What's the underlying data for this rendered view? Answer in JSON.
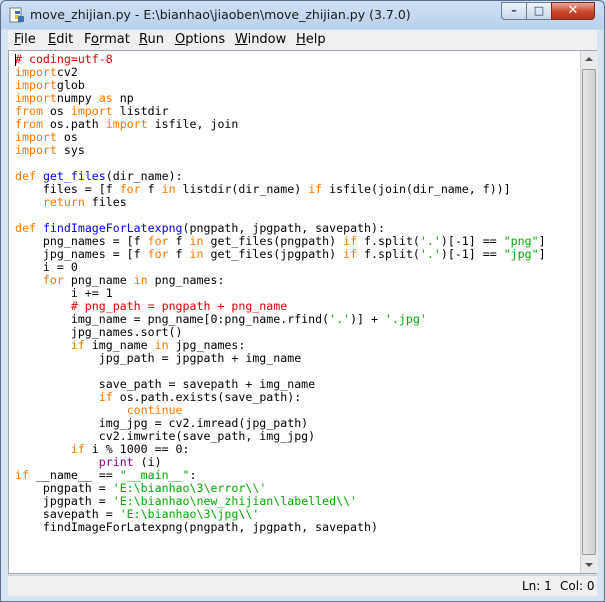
{
  "window": {
    "title": "move_zhijian.py - E:\\bianhao\\jiaoben\\move_zhijian.py (3.7.0)",
    "controls": {
      "minimize": "–",
      "maximize": "□",
      "close": "✕"
    }
  },
  "menu": {
    "items": [
      {
        "access": "F",
        "rest": "ile"
      },
      {
        "access": "E",
        "rest": "dit"
      },
      {
        "access": "",
        "pre": "F",
        "access2": "o",
        "rest": "rmat"
      },
      {
        "access": "R",
        "rest": "un"
      },
      {
        "access": "O",
        "rest": "ptions"
      },
      {
        "access": "W",
        "rest": "indow"
      },
      {
        "access": "H",
        "rest": "elp"
      }
    ]
  },
  "editor": {
    "lines": [
      [
        [
          "cm",
          "# coding=utf-8"
        ]
      ],
      [
        [
          "kw",
          "import"
        ],
        [
          "",
          "cv2"
        ]
      ],
      [
        [
          "kw",
          "import"
        ],
        [
          "",
          "glob"
        ]
      ],
      [
        [
          "kw",
          "import"
        ],
        [
          "",
          "numpy "
        ],
        [
          "kw",
          "as"
        ],
        [
          "",
          " np"
        ]
      ],
      [
        [
          "kw",
          "from"
        ],
        [
          "",
          " os "
        ],
        [
          "kw",
          "import"
        ],
        [
          "",
          " listdir"
        ]
      ],
      [
        [
          "kw",
          "from"
        ],
        [
          "",
          " os.path "
        ],
        [
          "kw",
          "import"
        ],
        [
          "",
          " isfile, join"
        ]
      ],
      [
        [
          "kw",
          "import"
        ],
        [
          "",
          " os"
        ]
      ],
      [
        [
          "kw",
          "import"
        ],
        [
          "",
          " sys"
        ]
      ],
      [
        [
          "",
          ""
        ]
      ],
      [
        [
          "kw",
          "def"
        ],
        [
          "",
          " "
        ],
        [
          "df",
          "get_files"
        ],
        [
          "",
          "(dir_name):"
        ]
      ],
      [
        [
          "",
          "    files = [f "
        ],
        [
          "kw",
          "for"
        ],
        [
          "",
          " f "
        ],
        [
          "kw",
          "in"
        ],
        [
          "",
          " listdir(dir_name) "
        ],
        [
          "kw",
          "if"
        ],
        [
          "",
          " isfile(join(dir_name, f))]"
        ]
      ],
      [
        [
          "",
          "    "
        ],
        [
          "kw",
          "return"
        ],
        [
          "",
          " files"
        ]
      ],
      [
        [
          "",
          ""
        ]
      ],
      [
        [
          "kw",
          "def"
        ],
        [
          "",
          " "
        ],
        [
          "df",
          "findImageForLatexpng"
        ],
        [
          "",
          "(pngpath, jpgpath, savepath):"
        ]
      ],
      [
        [
          "",
          "    png_names = [f "
        ],
        [
          "kw",
          "for"
        ],
        [
          "",
          " f "
        ],
        [
          "kw",
          "in"
        ],
        [
          "",
          " get_files(pngpath) "
        ],
        [
          "kw",
          "if"
        ],
        [
          "",
          " f.split("
        ],
        [
          "st",
          "'.'"
        ],
        [
          "",
          ")[-1] == "
        ],
        [
          "st",
          "\"png\""
        ],
        [
          "",
          "]"
        ]
      ],
      [
        [
          "",
          "    jpg_names = [f "
        ],
        [
          "kw",
          "for"
        ],
        [
          "",
          " f "
        ],
        [
          "kw",
          "in"
        ],
        [
          "",
          " get_files(jpgpath) "
        ],
        [
          "kw",
          "if"
        ],
        [
          "",
          " f.split("
        ],
        [
          "st",
          "'.'"
        ],
        [
          "",
          ")[-1] == "
        ],
        [
          "st",
          "\"jpg\""
        ],
        [
          "",
          "]"
        ]
      ],
      [
        [
          "",
          "    i = 0"
        ]
      ],
      [
        [
          "",
          "    "
        ],
        [
          "kw",
          "for"
        ],
        [
          "",
          " png_name "
        ],
        [
          "kw",
          "in"
        ],
        [
          "",
          " png_names:"
        ]
      ],
      [
        [
          "",
          "        i += 1"
        ]
      ],
      [
        [
          "",
          "        "
        ],
        [
          "cm",
          "# png_path = pngpath + png_name"
        ]
      ],
      [
        [
          "",
          "        img_name = png_name[0:png_name.rfind("
        ],
        [
          "st",
          "'.'"
        ],
        [
          "",
          ")] + "
        ],
        [
          "st",
          "'.jpg'"
        ]
      ],
      [
        [
          "",
          "        jpg_names.sort()"
        ]
      ],
      [
        [
          "",
          "        "
        ],
        [
          "kw",
          "if"
        ],
        [
          "",
          " img_name "
        ],
        [
          "kw",
          "in"
        ],
        [
          "",
          " jpg_names:"
        ]
      ],
      [
        [
          "",
          "            jpg_path = jpgpath + img_name"
        ]
      ],
      [
        [
          "",
          ""
        ]
      ],
      [
        [
          "",
          "            save_path = savepath + img_name"
        ]
      ],
      [
        [
          "",
          "            "
        ],
        [
          "kw",
          "if"
        ],
        [
          "",
          " os.path.exists(save_path):"
        ]
      ],
      [
        [
          "",
          "                "
        ],
        [
          "kw",
          "continue"
        ]
      ],
      [
        [
          "",
          "            img_jpg = cv2.imread(jpg_path)"
        ]
      ],
      [
        [
          "",
          "            cv2.imwrite(save_path, img_jpg)"
        ]
      ],
      [
        [
          "",
          "        "
        ],
        [
          "kw",
          "if"
        ],
        [
          "",
          " i % 1000 == 0:"
        ]
      ],
      [
        [
          "",
          "            "
        ],
        [
          "bi",
          "print"
        ],
        [
          "",
          " (i)"
        ]
      ],
      [
        [
          "kw",
          "if"
        ],
        [
          "",
          " __name__ == "
        ],
        [
          "st",
          "\"__main__\""
        ],
        [
          "",
          ":"
        ]
      ],
      [
        [
          "",
          "    pngpath = "
        ],
        [
          "st",
          "'E:\\bianhao\\3\\error\\\\'"
        ]
      ],
      [
        [
          "",
          "    jpgpath = "
        ],
        [
          "st",
          "'E:\\bianhao\\new_zhijian\\labelled\\\\'"
        ]
      ],
      [
        [
          "",
          "    savepath = "
        ],
        [
          "st",
          "'E:\\bianhao\\3\\jpg\\\\'"
        ]
      ],
      [
        [
          "",
          "    findImageForLatexpng(pngpath, jpgpath, savepath)"
        ]
      ]
    ]
  },
  "status": {
    "line": "Ln: 1",
    "col": "Col: 0"
  },
  "colors": {
    "keyword": "#ff7700",
    "comment": "#dd0000",
    "string": "#00aa00",
    "definition": "#0000ff",
    "builtin": "#900090"
  }
}
